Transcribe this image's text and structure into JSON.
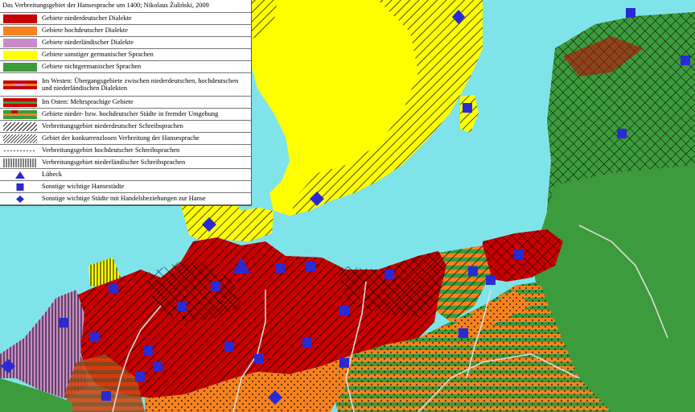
{
  "legend": {
    "title": "Das Verbreitungsgebiet der Hansesprache um 1400; Nikolaus Żuliński, 2009",
    "items": [
      {
        "key": "nd",
        "label": "Gebiete niederdeutscher Dialekte",
        "swatch": "solid",
        "color": "#c80000"
      },
      {
        "key": "hd",
        "label": "Gebiete hochdeutscher Dialekte",
        "swatch": "solid",
        "color": "#f5821e"
      },
      {
        "key": "nl",
        "label": "Gebiete niederländischer Dialekte",
        "swatch": "solid",
        "color": "#c88cc8"
      },
      {
        "key": "sg",
        "label": "Gebiete sonstiger germanischer Sprachen",
        "swatch": "solid",
        "color": "#ffff00"
      },
      {
        "key": "ng",
        "label": "Gebiete nichtgermanischer Sprachen",
        "swatch": "solid",
        "color": "#3c9b3c"
      },
      {
        "key": "west",
        "label": "Im Westen: Übergangsgebiete zwischen niederdeutschen, hochdeutschen und niederländischen Dialekten",
        "swatch": "stripes-west"
      },
      {
        "key": "ost",
        "label": "Im Osten: Mehrsprachige Gebiete",
        "swatch": "stripes-ost"
      },
      {
        "key": "staedte",
        "label": "Gebiete nieder- bzw. hochdeutscher Städte in fremder Umgebung",
        "swatch": "stripes-staedte"
      },
      {
        "key": "ndschreib",
        "label": "Verbreitungsgebiet niederdeutscher Schreibsprachen",
        "swatch": "diag"
      },
      {
        "key": "hanse",
        "label": "Gebiet der konkurrenzlosen Verbreitung der Hansesprache",
        "swatch": "crossdiag"
      },
      {
        "key": "hdschreib",
        "label": "Verbreitungsgebiet hochdeutscher Schreibsprachen",
        "swatch": "dots"
      },
      {
        "key": "nlschreib",
        "label": "Verbreitungsgebiet niederländischer Schreibsprachen",
        "swatch": "vert"
      },
      {
        "key": "luebeck",
        "label": "Lübeck",
        "swatch": "triangle"
      },
      {
        "key": "hansestaedte",
        "label": "Sonstige wichtige Hansestädte",
        "swatch": "square"
      },
      {
        "key": "handel",
        "label": "Sonstige wichtige Städte mit Handelsbeziehungen zur Hanse",
        "swatch": "diamond"
      }
    ]
  },
  "colors": {
    "sea": "#7fe3ea",
    "nd": "#c80000",
    "hd": "#f5821e",
    "nl": "#c88cc8",
    "sg": "#ffff00",
    "ng": "#3c9b3c",
    "marker": "#2a2ad4",
    "river": "#dddddd"
  },
  "markers": {
    "luebeck": {
      "name": "luebeck-marker"
    },
    "cities": {
      "count": 30
    }
  }
}
